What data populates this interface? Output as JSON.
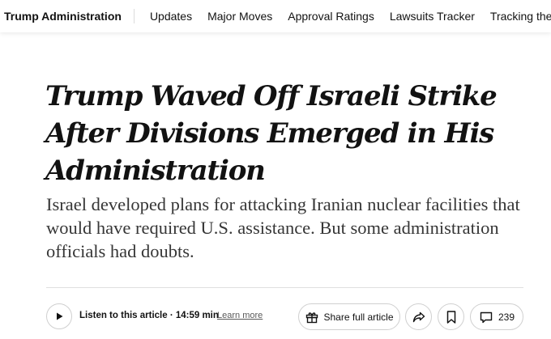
{
  "nav": {
    "section": "Trump Administration",
    "items": [
      "Updates",
      "Major Moves",
      "Approval Ratings",
      "Lawsuits Tracker",
      "Tracking the Layo"
    ]
  },
  "article": {
    "headline": "Trump Waved Off Israeli Strike After Divisions Emerged in His Administration",
    "summary": "Israel developed plans for attacking Iranian nuclear facilities that would have required U.S. assistance. But some administration officials had doubts."
  },
  "toolbar": {
    "listen_label": "Listen to this article · 14:59 min",
    "learn_more": "Learn more",
    "share_full_label": "Share full article",
    "comments_count": "239",
    "icons": [
      "play-icon",
      "gift-icon",
      "share-arrow-icon",
      "bookmark-icon",
      "comment-icon"
    ]
  }
}
